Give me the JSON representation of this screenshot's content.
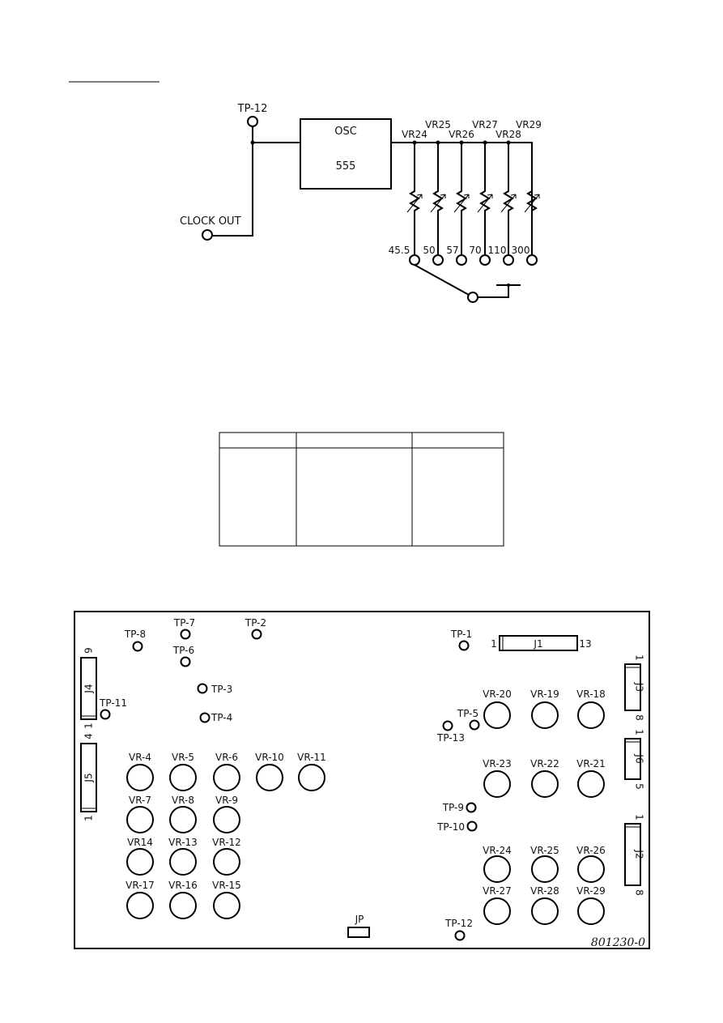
{
  "schematic": {
    "test_point": "TP-12",
    "clock_out": "CLOCK OUT",
    "osc_label": "OSC",
    "osc_chip": "555",
    "resistors": [
      "VR24",
      "VR25",
      "VR26",
      "VR27",
      "VR28",
      "VR29"
    ],
    "values": [
      "45.5",
      "50",
      "57",
      "70",
      "110",
      "300"
    ]
  },
  "table": {
    "columns": 3,
    "rows": 1
  },
  "pcb": {
    "part_number": "801230-0",
    "test_points": [
      "TP-1",
      "TP-2",
      "TP-3",
      "TP-4",
      "TP-5",
      "TP-6",
      "TP-7",
      "TP-8",
      "TP-9",
      "TP-10",
      "TP-11",
      "TP-12",
      "TP-13"
    ],
    "left_vr_rows": [
      [
        "VR-4",
        "VR-5",
        "VR-6",
        "VR-10",
        "VR-11"
      ],
      [
        "VR-7",
        "VR-8",
        "VR-9"
      ],
      [
        "VR14",
        "VR-13",
        "VR-12"
      ],
      [
        "VR-17",
        "VR-16",
        "VR-15"
      ]
    ],
    "right_vr_rows": [
      [
        "VR-20",
        "VR-19",
        "VR-18"
      ],
      [
        "VR-23",
        "VR-22",
        "VR-21"
      ],
      [
        "VR-24",
        "VR-25",
        "VR-26"
      ],
      [
        "VR-27",
        "VR-28",
        "VR-29"
      ]
    ],
    "connectors": {
      "J1": {
        "name": "J1",
        "pin_start": "1",
        "pin_end": "13"
      },
      "J2": {
        "name": "J2",
        "pin_start": "1",
        "pin_end": "8"
      },
      "J3": {
        "name": "J3",
        "pin_start": "1",
        "pin_end": "8"
      },
      "J4": {
        "name": "J4",
        "pin_start": "1",
        "pin_end": "9"
      },
      "J5": {
        "name": "J5",
        "pin_start": "1",
        "pin_end": "4"
      },
      "J6": {
        "name": "J6",
        "pin_start": "1",
        "pin_end": "5"
      }
    },
    "jumper": "JP"
  }
}
